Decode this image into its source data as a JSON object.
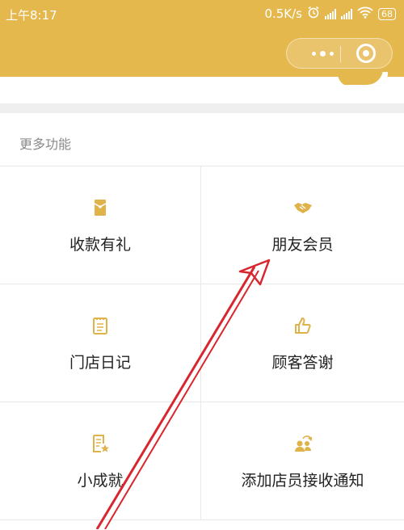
{
  "status_bar": {
    "time": "上午8:17",
    "network_speed": "0.5K/s",
    "battery": "68"
  },
  "section": {
    "title": "更多功能"
  },
  "features": [
    {
      "label": "收款有礼",
      "icon": "gift-envelope-icon"
    },
    {
      "label": "朋友会员",
      "icon": "handshake-icon"
    },
    {
      "label": "门店日记",
      "icon": "clipboard-icon"
    },
    {
      "label": "顾客答谢",
      "icon": "thumbs-up-icon"
    },
    {
      "label": "小成就",
      "icon": "document-star-icon"
    },
    {
      "label": "添加店员接收通知",
      "icon": "add-staff-icon"
    }
  ],
  "colors": {
    "brand": "#e5b84e",
    "icon": "#e0b24a",
    "annotation_arrow": "#d8262e"
  }
}
